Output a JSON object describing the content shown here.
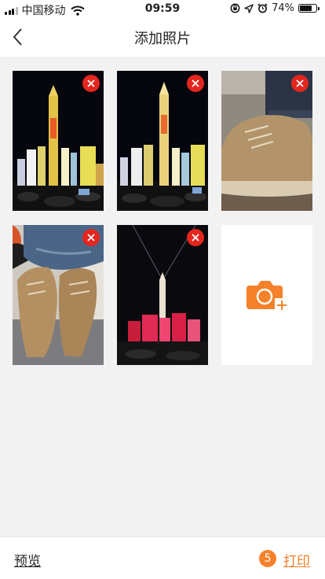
{
  "status_bar": {
    "carrier": "中国移动",
    "time": "09:59",
    "battery_percent": "74%",
    "battery_level": 0.74
  },
  "nav": {
    "back_icon": "chevron-left-icon",
    "title": "添加照片"
  },
  "photos": [
    {
      "subject": "city-tower-night",
      "delete_icon": "close-icon"
    },
    {
      "subject": "city-tower-night",
      "delete_icon": "close-icon"
    },
    {
      "subject": "suede-shoe-on-wood",
      "delete_icon": "close-icon"
    },
    {
      "subject": "shoes-and-jeans",
      "delete_icon": "close-icon"
    },
    {
      "subject": "tower-light-show",
      "delete_icon": "close-icon"
    }
  ],
  "add_tile": {
    "icon": "camera-add-icon"
  },
  "bottom_bar": {
    "preview_label": "预览",
    "count": "5",
    "print_label": "打印"
  },
  "colors": {
    "accent": "#f5812a",
    "delete_red": "#e4261f",
    "background": "#f2f2f2"
  }
}
